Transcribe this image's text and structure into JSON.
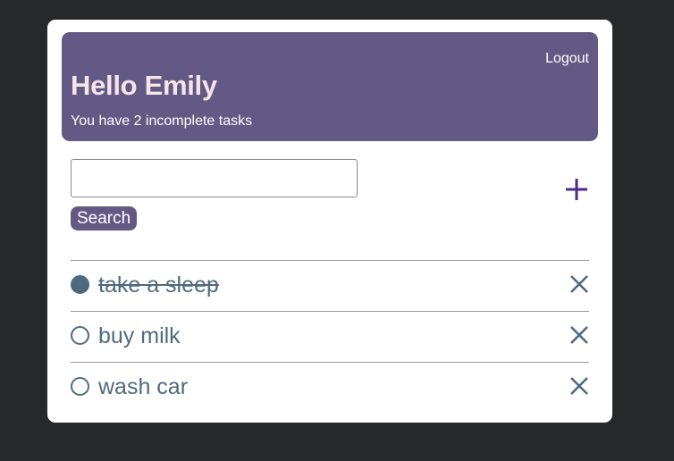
{
  "header": {
    "logout_label": "Logout",
    "greeting": "Hello Emily",
    "subtitle": "You have 2 incomplete tasks"
  },
  "search": {
    "value": "",
    "placeholder": "",
    "button_label": "Search"
  },
  "add_button": {
    "icon": "plus-icon"
  },
  "tasks": [
    {
      "label": "take a sleep",
      "completed": true
    },
    {
      "label": "buy milk",
      "completed": false
    },
    {
      "label": "wash car",
      "completed": false
    }
  ],
  "colors": {
    "page_background": "#27282a",
    "card_background": "#ffffff",
    "header_background": "#635985",
    "greeting_text": "#f7e6e9",
    "accent_plus": "#4c2a8a",
    "task_text": "#50697f",
    "divider": "#9a9a9a"
  },
  "icons": {
    "add": "plus-icon",
    "delete": "close-icon",
    "task_done": "filled-circle-icon",
    "task_open": "empty-circle-icon"
  }
}
